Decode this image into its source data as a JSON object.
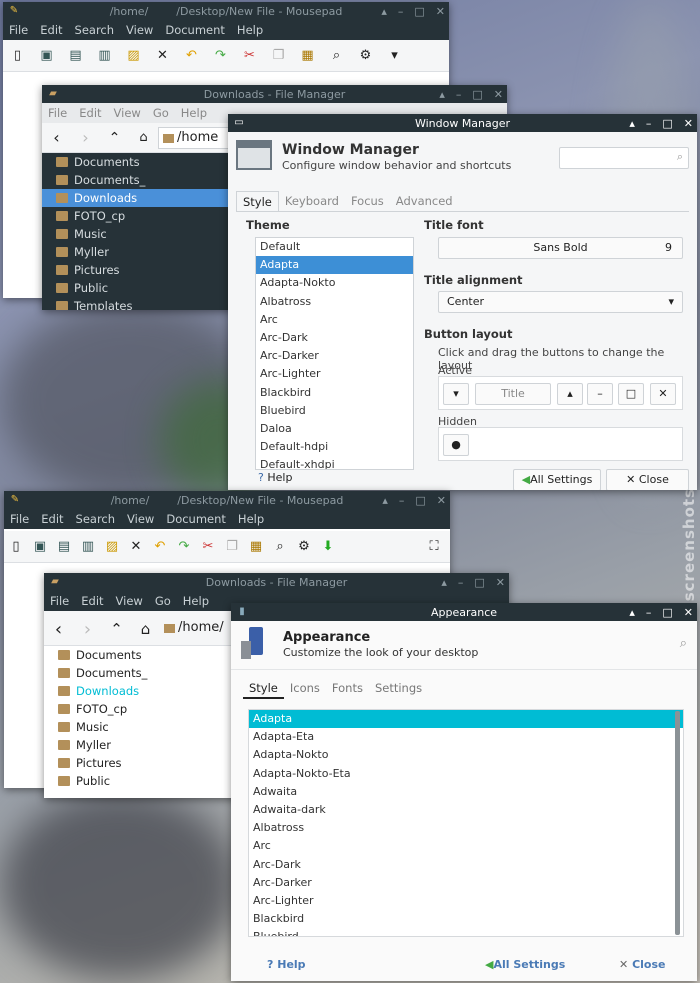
{
  "watermark": "screenshots.debian.net",
  "top": {
    "mousepad": {
      "title_dim": "/home/",
      "title": "/Desktop/New File - Mousepad",
      "menu": [
        "File",
        "Edit",
        "Search",
        "View",
        "Document",
        "Help"
      ]
    },
    "filemanager": {
      "title": "Downloads - File Manager",
      "menu": [
        "File",
        "Edit",
        "View",
        "Go",
        "Help"
      ],
      "path": "/home",
      "places": [
        "Documents",
        "Documents_",
        "Downloads",
        "FOTO_cp",
        "Music",
        "Myller",
        "Pictures",
        "Public",
        "Templates"
      ],
      "selected": 2
    },
    "wm": {
      "title": "Window Manager",
      "heading": "Window Manager",
      "subheading": "Configure window behavior and shortcuts",
      "tabs": [
        "Style",
        "Keyboard",
        "Focus",
        "Advanced"
      ],
      "theme_label": "Theme",
      "themes": [
        "Default",
        "Adapta",
        "Adapta-Nokto",
        "Albatross",
        "Arc",
        "Arc-Dark",
        "Arc-Darker",
        "Arc-Lighter",
        "Blackbird",
        "Bluebird",
        "Daloa",
        "Default-hdpi",
        "Default-xhdpi"
      ],
      "theme_selected": 1,
      "title_font_label": "Title font",
      "font_name": "Sans Bold",
      "font_size": "9",
      "title_alignment_label": "Title alignment",
      "alignment": "Center",
      "button_layout_label": "Button layout",
      "button_layout_hint": "Click and drag the buttons to change the layout",
      "active_label": "Active",
      "active_title": "Title",
      "hidden_label": "Hidden",
      "help": "Help",
      "all_settings": "All Settings",
      "close": "Close"
    }
  },
  "bottom": {
    "mousepad": {
      "title_dim": "/home/",
      "title": "/Desktop/New File - Mousepad",
      "menu": [
        "File",
        "Edit",
        "Search",
        "View",
        "Document",
        "Help"
      ]
    },
    "filemanager": {
      "title": "Downloads - File Manager",
      "menu": [
        "File",
        "Edit",
        "View",
        "Go",
        "Help"
      ],
      "path": "/home/",
      "places": [
        "Documents",
        "Documents_",
        "Downloads",
        "FOTO_cp",
        "Music",
        "Myller",
        "Pictures",
        "Public"
      ],
      "selected": 2
    },
    "appearance": {
      "title": "Appearance",
      "heading": "Appearance",
      "subheading": "Customize the look of your desktop",
      "tabs": [
        "Style",
        "Icons",
        "Fonts",
        "Settings"
      ],
      "themes": [
        "Adapta",
        "Adapta-Eta",
        "Adapta-Nokto",
        "Adapta-Nokto-Eta",
        "Adwaita",
        "Adwaita-dark",
        "Albatross",
        "Arc",
        "Arc-Dark",
        "Arc-Darker",
        "Arc-Lighter",
        "Blackbird",
        "Bluebird"
      ],
      "theme_selected": 0,
      "help": "Help",
      "all_settings": "All Settings",
      "close": "Close"
    }
  },
  "colors": {
    "titlebar": "#263238",
    "selection": "#3d8fd6",
    "accent_cyan": "#00bcd4"
  }
}
